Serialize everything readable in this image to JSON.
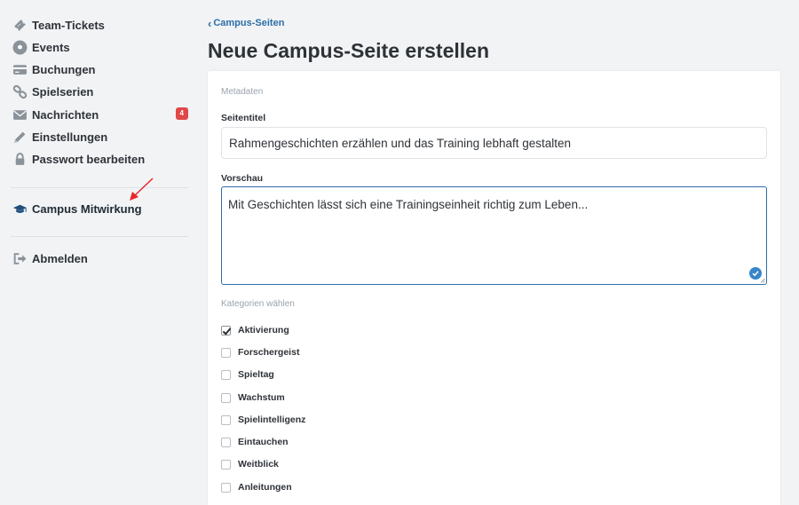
{
  "sidebar": {
    "items": [
      {
        "label": "Team-Tickets",
        "icon": "ticket-icon"
      },
      {
        "label": "Events",
        "icon": "soccer-ball-icon"
      },
      {
        "label": "Buchungen",
        "icon": "credit-card-icon"
      },
      {
        "label": "Spielserien",
        "icon": "link-icon"
      },
      {
        "label": "Nachrichten",
        "icon": "envelope-icon",
        "badge": "4"
      },
      {
        "label": "Einstellungen",
        "icon": "pencil-icon"
      },
      {
        "label": "Passwort bearbeiten",
        "icon": "lock-icon"
      }
    ],
    "campus": {
      "label": "Campus Mitwirkung",
      "icon": "graduation-cap-icon"
    },
    "logout": {
      "label": "Abmelden",
      "icon": "sign-out-icon"
    }
  },
  "breadcrumb": {
    "back_label": "Campus-Seiten"
  },
  "page": {
    "title": "Neue Campus-Seite erstellen"
  },
  "form": {
    "section_meta": "Metadaten",
    "title_label": "Seitentitel",
    "title_value": "Rahmengeschichten erzählen und das Training lebhaft gestalten",
    "preview_label": "Vorschau",
    "preview_value": "Mit Geschichten lässt sich eine Trainingseinheit richtig zum Leben...",
    "categories_label": "Kategorien wählen",
    "categories": [
      {
        "label": "Aktivierung",
        "checked": true
      },
      {
        "label": "Forschergeist",
        "checked": false
      },
      {
        "label": "Spieltag",
        "checked": false
      },
      {
        "label": "Wachstum",
        "checked": false
      },
      {
        "label": "Spielintelligenz",
        "checked": false
      },
      {
        "label": "Eintauchen",
        "checked": false
      },
      {
        "label": "Weitblick",
        "checked": false
      },
      {
        "label": "Anleitungen",
        "checked": false
      }
    ]
  },
  "colors": {
    "accent": "#2f6eaa",
    "badge": "#e04848",
    "annotation_arrow": "#e8272a"
  }
}
